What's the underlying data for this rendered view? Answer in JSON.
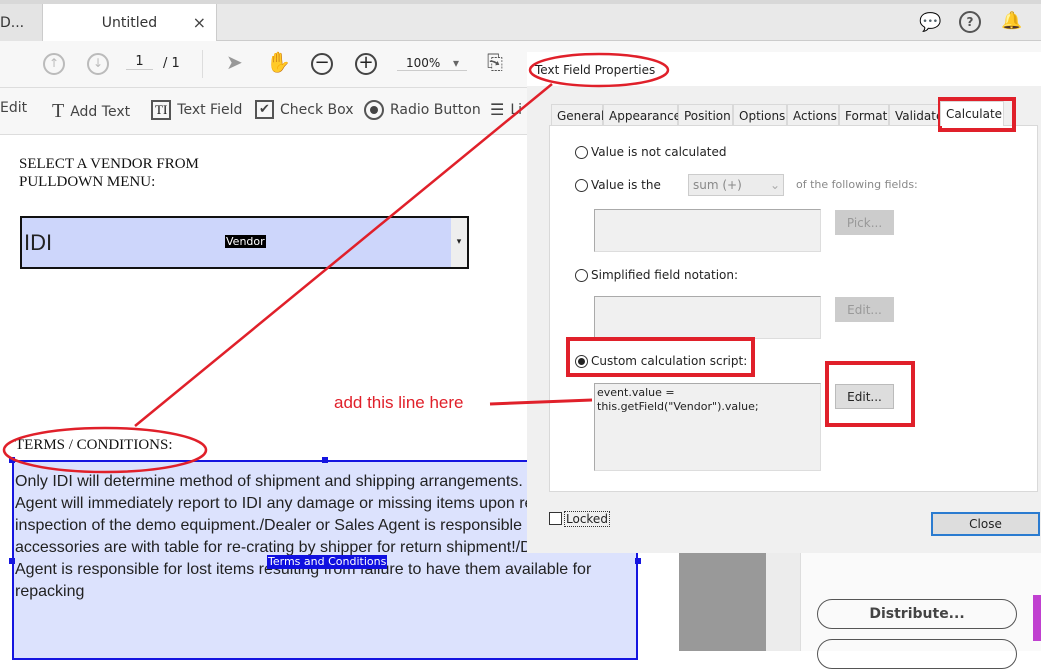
{
  "tabs": [
    {
      "label": "D..."
    },
    {
      "label": "Untitled",
      "close": "×"
    }
  ],
  "header_icons": [
    "comment-icon",
    "help-icon",
    "bell-icon"
  ],
  "toolbar": {
    "page_current": "1",
    "page_total": "/ 1",
    "zoom": "100%"
  },
  "tools": [
    {
      "label": "Edit",
      "icon": "edit-icon"
    },
    {
      "label": "Add Text",
      "icon": "text-icon"
    },
    {
      "label": "Text Field",
      "icon": "text-field-icon"
    },
    {
      "label": "Check Box",
      "icon": "checkbox-icon"
    },
    {
      "label": "Radio Button",
      "icon": "radio-icon"
    },
    {
      "label": "Li",
      "icon": "list-box-icon"
    }
  ],
  "document": {
    "vendor_label_line1": "SELECT A VENDOR FROM",
    "vendor_label_line2": "PULLDOWN MENU:",
    "vendor_value": "IDI",
    "vendor_field_name": "Vendor",
    "terms_label": "TERMS / CONDITIONS:",
    "terms_field_name": "Terms and Conditions",
    "terms_lines": [
      "Only IDI will determine method of shipment and shipping arrangements. .",
      "Agent will immediately report to IDI any damage or missing items upon re",
      "inspection of the demo equipment./Dealer or Sales Agent is responsible",
      "accessories are with table for re-crating by shipper for return shipment!/D",
      "Agent is responsible for lost items resulting from failure to have them available for",
      "repacking"
    ]
  },
  "dialog": {
    "title": "Text Field Properties",
    "tabs": [
      "General",
      "Appearance",
      "Position",
      "Options",
      "Actions",
      "Format",
      "Validate",
      "Calculate"
    ],
    "active_tab": "Calculate",
    "opt_not_calculated": "Value is not calculated",
    "opt_value_is": "Value is the",
    "operation": "sum (+)",
    "of_fields": "of the following fields:",
    "pick": "Pick...",
    "opt_simplified": "Simplified field notation:",
    "edit_disabled": "Edit...",
    "opt_custom": "Custom calculation script:",
    "selected_option": "Custom calculation script:",
    "script_line1": "event.value =",
    "script_line2": "this.getField(\"Vendor\").value;",
    "edit": "Edit...",
    "locked": "Locked",
    "locked_checked": false,
    "close": "Close"
  },
  "side_panel": {
    "distribute": "Distribute..."
  },
  "annotation": {
    "text": "add this line here",
    "color": "#e0202a"
  }
}
